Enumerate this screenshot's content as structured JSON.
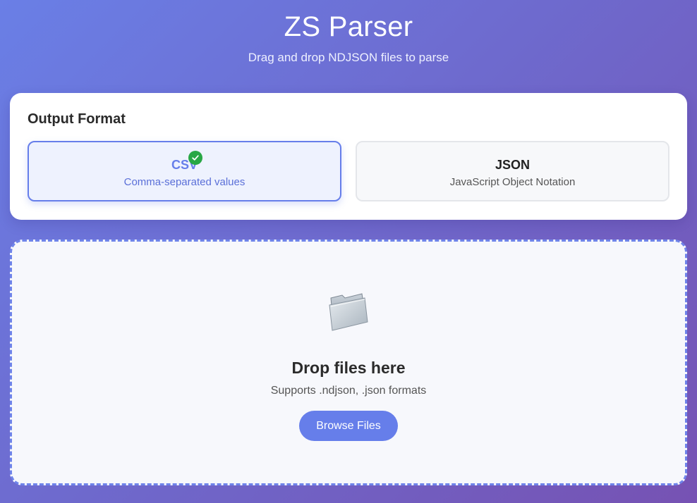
{
  "header": {
    "title": "ZS Parser",
    "subtitle": "Drag and drop NDJSON files to parse"
  },
  "output_format": {
    "heading": "Output Format",
    "selected": "CSV",
    "options": [
      {
        "label": "CSV",
        "description": "Comma-separated values",
        "selected": true
      },
      {
        "label": "JSON",
        "description": "JavaScript Object Notation",
        "selected": false
      }
    ]
  },
  "dropzone": {
    "icon": "folder-icon",
    "title": "Drop files here",
    "subtitle": "Supports .ndjson, .json formats",
    "button_label": "Browse Files"
  },
  "colors": {
    "accent": "#667eea",
    "check": "#28a745",
    "background_start": "#6a7fe6",
    "background_end": "#7652b3"
  }
}
